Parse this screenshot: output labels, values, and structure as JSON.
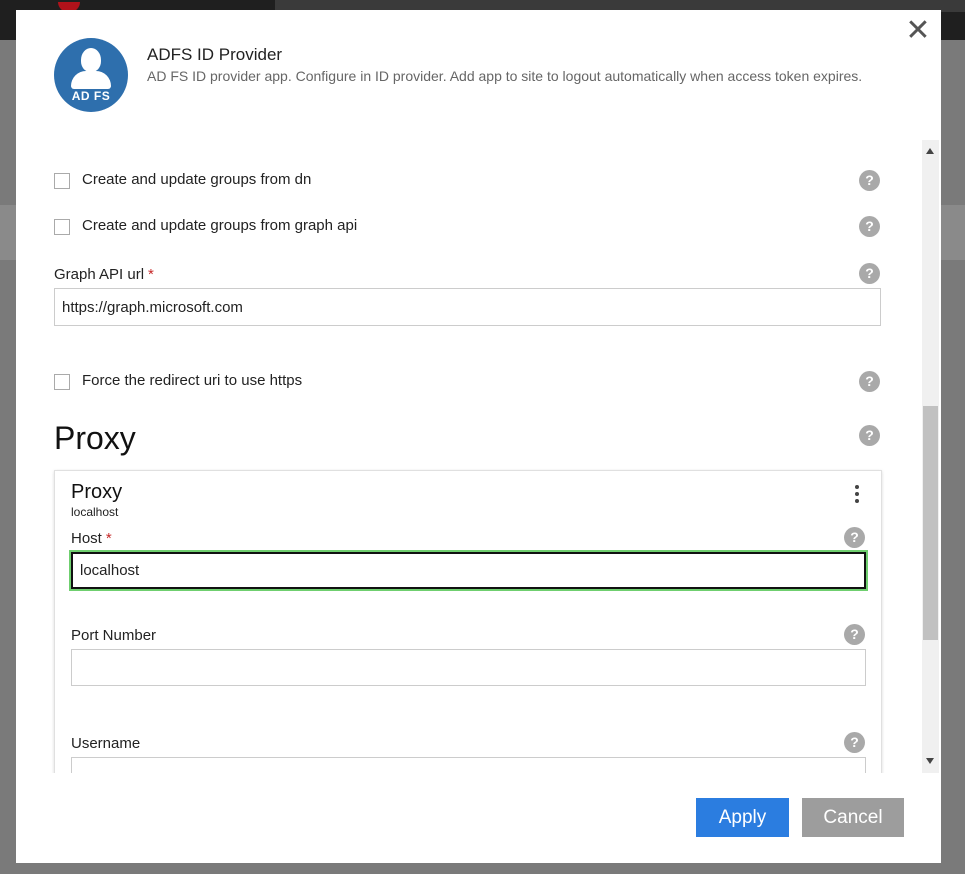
{
  "dialog": {
    "title": "ADFS ID Provider",
    "description": "AD FS ID provider app. Configure in ID provider. Add app to site to logout automatically when access token expires.",
    "avatar_label": "AD FS",
    "close_glyph": "✕",
    "accent_color": "#2e6fad"
  },
  "fields": {
    "groups_from_dn": {
      "label": "Create and update groups from dn",
      "checked": false
    },
    "groups_from_graph": {
      "label": "Create and update groups from graph api",
      "checked": false
    },
    "graph_api_url": {
      "label": "Graph API url",
      "required_mark": "*",
      "value": "https://graph.microsoft.com"
    },
    "force_https": {
      "label": "Force the redirect uri to use https",
      "checked": false
    }
  },
  "help_glyph": "?",
  "proxy_section": {
    "heading": "Proxy",
    "card": {
      "title": "Proxy",
      "subtitle": "localhost",
      "host": {
        "label": "Host",
        "required_mark": "*",
        "value": "localhost"
      },
      "port": {
        "label": "Port Number",
        "value": ""
      },
      "username": {
        "label": "Username",
        "value": ""
      }
    }
  },
  "footer": {
    "apply_label": "Apply",
    "cancel_label": "Cancel",
    "apply_color": "#2b7de0",
    "cancel_color": "#9d9d9d"
  }
}
